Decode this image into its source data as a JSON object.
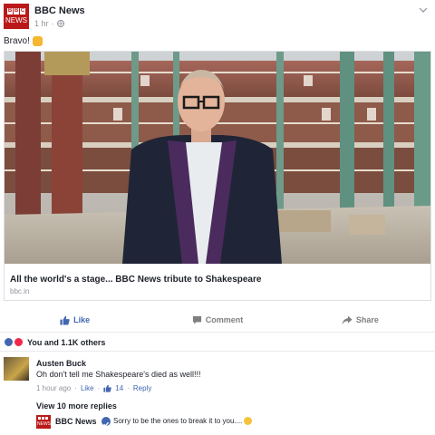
{
  "post": {
    "author": "BBC News",
    "time": "1 hr",
    "separator": "·",
    "text": "Bravo!",
    "logo_text": "NEWS",
    "logo_letters": [
      "B",
      "B",
      "C"
    ]
  },
  "link_card": {
    "title": "All the world's a stage... BBC News tribute to Shakespeare",
    "domain": "bbc.in"
  },
  "actions": {
    "like": "Like",
    "comment": "Comment",
    "share": "Share"
  },
  "reactions": {
    "summary": "You and 1.1K others"
  },
  "comment": {
    "author": "Austen Buck",
    "text": "Oh don't tell me Shakespeare's died as well!!!",
    "time": "1 hour ago",
    "dot": "·",
    "like_link": "Like",
    "like_count": "14",
    "reply_link": "Reply"
  },
  "replies": {
    "view_more": "View 10 more replies",
    "author": "BBC News",
    "text": "Sorry to be the ones to break it to you....",
    "logo_text": "NEWS"
  },
  "colors": {
    "facebook_blue": "#4267b2",
    "bbc_red": "#bb1919",
    "muted": "#90949c"
  }
}
